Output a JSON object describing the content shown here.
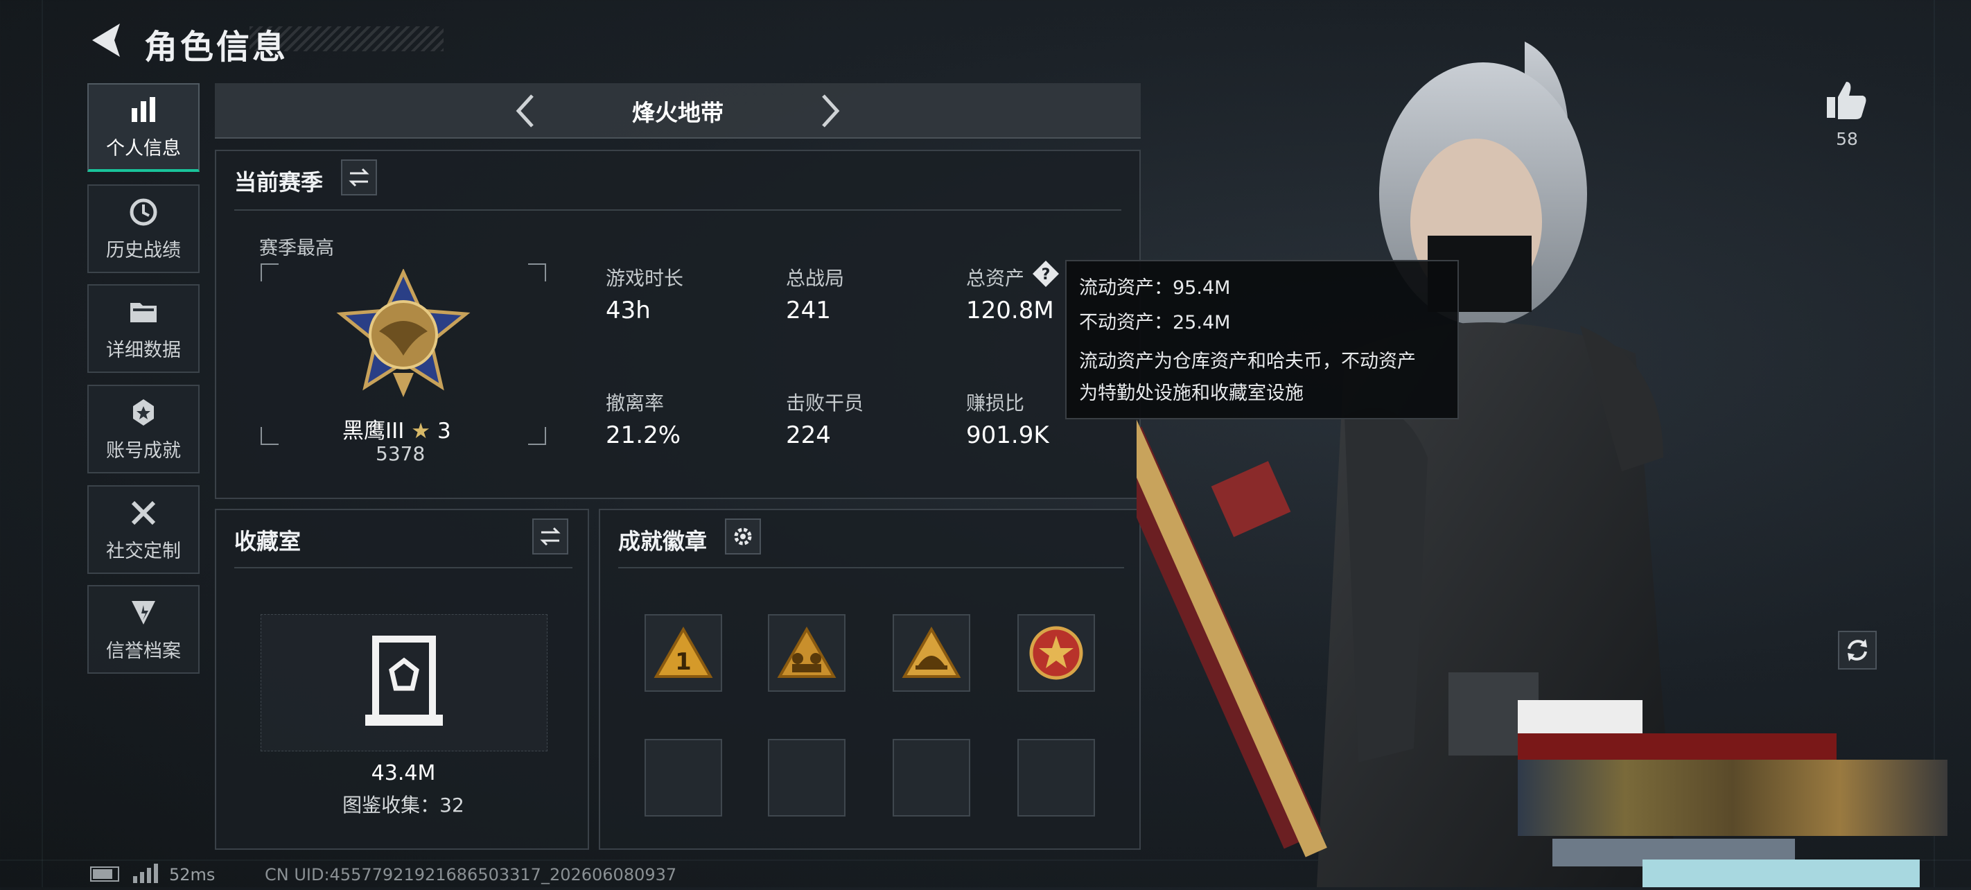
{
  "header": {
    "title": "角色信息"
  },
  "sidebar": {
    "items": [
      {
        "label": "个人信息",
        "icon": "bar-chart-icon",
        "active": true
      },
      {
        "label": "历史战绩",
        "icon": "history-clock-icon"
      },
      {
        "label": "详细数据",
        "icon": "folder-icon"
      },
      {
        "label": "账号成就",
        "icon": "achievement-icon"
      },
      {
        "label": "社交定制",
        "icon": "tools-icon"
      },
      {
        "label": "信誉档案",
        "icon": "credit-shield-icon"
      }
    ]
  },
  "mode_selector": {
    "label": "烽火地带"
  },
  "season": {
    "title": "当前赛季",
    "best_label": "赛季最高",
    "rank_name": "黑鹰III",
    "rank_stars": "3",
    "rank_score": "5378",
    "stats": [
      {
        "label": "游戏时长",
        "value": "43h"
      },
      {
        "label": "总战局",
        "value": "241"
      },
      {
        "label": "总资产",
        "value": "120.8M"
      },
      {
        "label": "撤离率",
        "value": "21.2%"
      },
      {
        "label": "击败干员",
        "value": "224"
      },
      {
        "label": "赚损比",
        "value": "901.9K"
      }
    ]
  },
  "tooltip": {
    "line1": "流动资产：95.4M",
    "line2": "不动资产：25.4M",
    "desc1": "流动资产为仓库资产和哈夫币，不动资产",
    "desc2": "为特勤处设施和收藏室设施"
  },
  "collection": {
    "title": "收藏室",
    "value": "43.4M",
    "catalog": "图鉴收集：32"
  },
  "badges": {
    "title": "成就徽章"
  },
  "likes": {
    "count": "58"
  },
  "footer": {
    "ping": "52ms",
    "uid": "CN UID:4557792192168650331​7_202606080937"
  },
  "colors": {
    "accent": "#19c39a",
    "panel_border": "#3a4148",
    "background": "#1b2127"
  }
}
